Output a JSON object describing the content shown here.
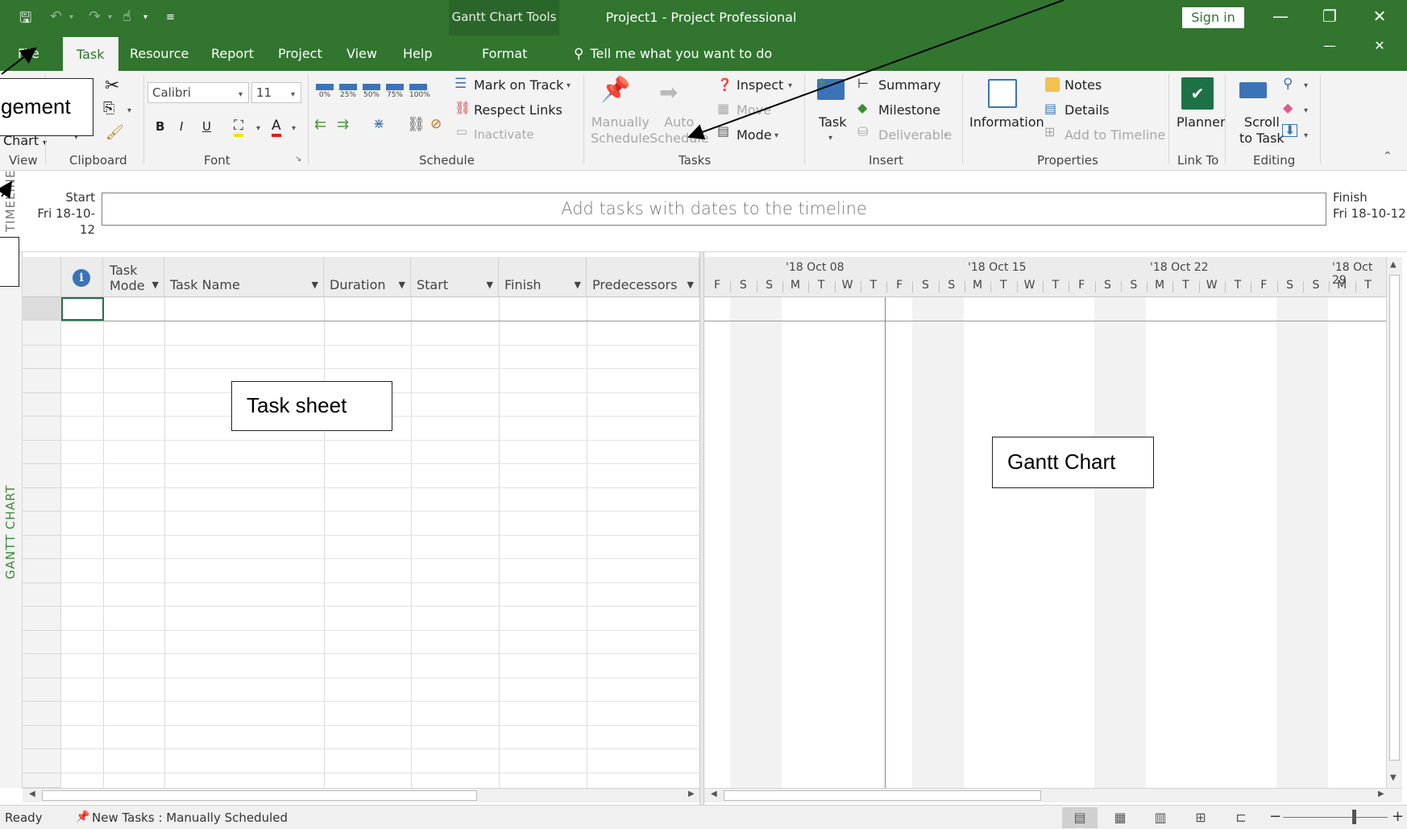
{
  "titlebar": {
    "tools_label": "Gantt Chart Tools",
    "window_title": "Project1  -  Project Professional",
    "sign_in": "Sign in",
    "minimize": "—",
    "restore": "❐",
    "close": "✕"
  },
  "tabs": {
    "file": "File",
    "task": "Task",
    "resource": "Resource",
    "report": "Report",
    "project": "Project",
    "view": "View",
    "help": "Help",
    "format": "Format",
    "tell_me": "Tell me what you want to do",
    "doc_minimize": "—",
    "doc_close": "✕"
  },
  "ribbon": {
    "view_chart": "Chart",
    "groups": {
      "view": "View",
      "clipboard": "Clipboard",
      "font": "Font",
      "schedule": "Schedule",
      "tasks": "Tasks",
      "insert": "Insert",
      "properties": "Properties",
      "link_to": "Link To",
      "editing": "Editing"
    },
    "font_name": "Calibri",
    "font_size": "11",
    "bold": "B",
    "italic": "I",
    "underline": "U",
    "pct": [
      "0%",
      "25%",
      "50%",
      "75%",
      "100%"
    ],
    "mark_on_track": "Mark on Track",
    "respect_links": "Respect Links",
    "inactivate": "Inactivate",
    "manually": "Manually",
    "schedule_word": "Schedule",
    "auto": "Auto",
    "inspect": "Inspect",
    "move": "Move",
    "mode": "Mode",
    "task": "Task",
    "summary": "Summary",
    "milestone": "Milestone",
    "deliverable": "Deliverable",
    "information": "Information",
    "notes": "Notes",
    "details": "Details",
    "add_to_timeline": "Add to Timeline",
    "planner": "Planner",
    "scroll": "Scroll",
    "to_task": "to Task"
  },
  "timeline": {
    "label": "TIMELINE",
    "start_label": "Start",
    "start_date": "Fri 18-10-12",
    "finish_label": "Finish",
    "finish_date": "Fri 18-10-12",
    "placeholder": "Add tasks with dates to the timeline"
  },
  "gantt_label": "GANTT CHART",
  "sheet": {
    "columns": {
      "task_mode_1": "Task",
      "task_mode_2": "Mode",
      "task_name": "Task Name",
      "duration": "Duration",
      "start": "Start",
      "finish": "Finish",
      "predecessors": "Predecessors"
    }
  },
  "gantt": {
    "weeks": [
      "'18 Oct 08",
      "'18 Oct 15",
      "'18 Oct 22",
      "'18 Oct 29"
    ],
    "days": [
      "F",
      "S",
      "S",
      "M",
      "T",
      "W",
      "T",
      "F",
      "S",
      "S",
      "M",
      "T",
      "W",
      "T",
      "F",
      "S",
      "S",
      "M",
      "T",
      "W",
      "T",
      "F",
      "S",
      "S",
      "M",
      "T"
    ]
  },
  "status": {
    "ready": "Ready",
    "new_tasks": "New Tasks : Manually Scheduled"
  },
  "callouts": {
    "top_left": "gement",
    "task_sheet": "Task sheet",
    "gantt_chart": "Gantt Chart"
  }
}
